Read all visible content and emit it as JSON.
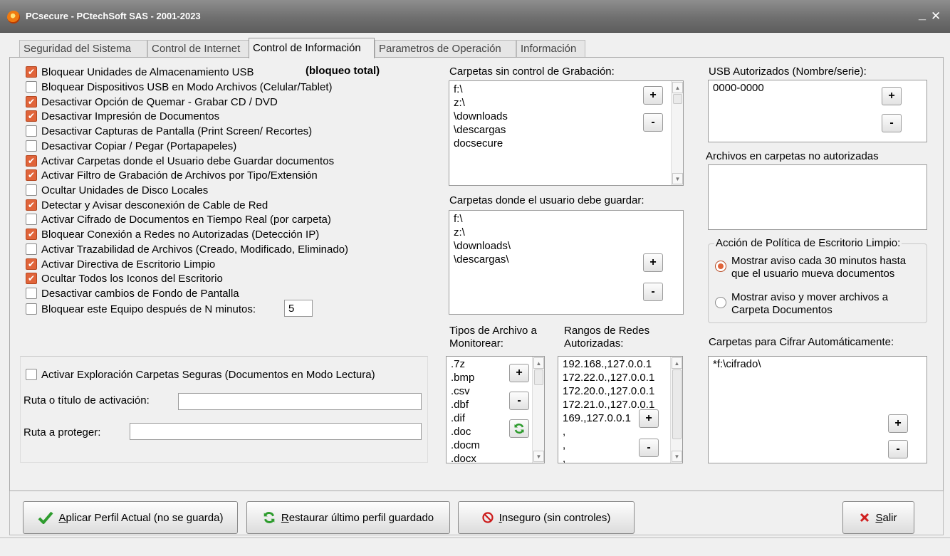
{
  "window": {
    "title": "PCsecure  -  PCtechSoft SAS - 2001-2023",
    "minimize_glyph": "_",
    "close_glyph": "✕"
  },
  "tabs": [
    {
      "label": "Seguridad del Sistema"
    },
    {
      "label": "Control de Internet"
    },
    {
      "label": "Control de Información"
    },
    {
      "label": "Parametros de Operación"
    },
    {
      "label": "Información"
    }
  ],
  "active_tab": "Control de Información",
  "options": [
    {
      "label": "Bloquear Unidades de Almacenamiento USB",
      "checked": true
    },
    {
      "label": "Bloquear Dispositivos USB en Modo Archivos (Celular/Tablet)",
      "checked": false
    },
    {
      "label": "Desactivar Opción de  Quemar - Grabar CD / DVD",
      "checked": true
    },
    {
      "label": "Desactivar Impresión de Documentos",
      "checked": true
    },
    {
      "label": "Desactivar Capturas de Pantalla (Print Screen/ Recortes)",
      "checked": false
    },
    {
      "label": "Desactivar Copiar / Pegar (Portapapeles)",
      "checked": false
    },
    {
      "label": "Activar Carpetas donde el Usuario debe Guardar documentos",
      "checked": true
    },
    {
      "label": "Activar Filtro de Grabación de Archivos por Tipo/Extensión",
      "checked": true
    },
    {
      "label": "Ocultar Unidades de Disco Locales",
      "checked": false
    },
    {
      "label": "Detectar y Avisar desconexión de Cable de Red",
      "checked": true
    },
    {
      "label": "Activar Cifrado de Documentos en Tiempo Real (por carpeta)",
      "checked": false
    },
    {
      "label": "Bloquear Conexión a Redes no Autorizadas (Detección IP)",
      "checked": true
    },
    {
      "label": "Activar Trazabilidad de Archivos (Creado, Modificado, Eliminado)",
      "checked": false
    },
    {
      "label": "Activar Directiva de Escritorio Limpio",
      "checked": true
    },
    {
      "label": "Ocultar Todos los Iconos del Escritorio",
      "checked": true
    },
    {
      "label": "Desactivar cambios de Fondo de Pantalla",
      "checked": false
    },
    {
      "label": "Bloquear este Equipo después de N minutos:",
      "checked": false
    }
  ],
  "bloqueo_total_label": "(bloqueo total)",
  "lock_minutes_value": "5",
  "secure_folders": {
    "checkbox_label": "Activar Exploración Carpetas Seguras (Documentos en Modo Lectura)",
    "checked": false,
    "activation_path_label": "Ruta o título de activación:",
    "activation_path_value": "",
    "protect_path_label": "Ruta a proteger:",
    "protect_path_value": ""
  },
  "no_control_folders": {
    "label": "Carpetas sin control de Grabación:",
    "items": [
      "f:\\",
      "z:\\",
      "\\downloads",
      "\\descargas",
      "docsecure"
    ]
  },
  "save_folders": {
    "label": "Carpetas donde el usuario debe guardar:",
    "items": [
      "f:\\",
      "z:\\",
      "\\downloads\\",
      "\\descargas\\"
    ]
  },
  "file_types": {
    "label_line1": "Tipos de Archivo a",
    "label_line2": "Monitorear:",
    "items": [
      ".7z",
      ".bmp",
      ".csv",
      ".dbf",
      ".dif",
      ".doc",
      ".docm",
      ".docx"
    ]
  },
  "network_ranges": {
    "label_line1": "Rangos de Redes",
    "label_line2": "Autorizadas:",
    "items": [
      "192.168.,127.0.0.1",
      "172.22.0.,127.0.0.1",
      "172.20.0.,127.0.0.1",
      "172.21.0.,127.0.0.1",
      "169.,127.0.0.1",
      ",",
      ",",
      ","
    ]
  },
  "usb_authorized": {
    "label": "USB Autorizados (Nombre/serie):",
    "items": [
      "0000-0000"
    ]
  },
  "unauthorized_files": {
    "label": "Archivos en carpetas no autorizadas",
    "items": []
  },
  "clean_desk_policy": {
    "title": "Acción de Política de Escritorio Limpio:",
    "options": [
      {
        "line1": "Mostrar aviso cada 30 minutos hasta",
        "line2": "que el usuario mueva documentos",
        "selected": true
      },
      {
        "line1": "Mostrar aviso y mover archivos a",
        "line2": "Carpeta Documentos",
        "selected": false
      }
    ]
  },
  "encrypt_folders": {
    "label": "Carpetas para Cifrar Automáticamente:",
    "items": [
      "*f:\\cifrado\\"
    ]
  },
  "small_buttons": {
    "add": "+",
    "remove": "-"
  },
  "buttons": {
    "apply": {
      "mnemonic": "A",
      "rest": "plicar Perfil Actual (no se guarda)"
    },
    "restore": {
      "mnemonic": "R",
      "rest": "estaurar último perfil guardado"
    },
    "insecure": {
      "mnemonic": "I",
      "rest": "nseguro (sin controles)"
    },
    "exit": {
      "mnemonic": "S",
      "rest": "alir"
    }
  },
  "colors": {
    "check_accent": "#e0643a",
    "titlebar": "#767676",
    "apply_icon": "#2e9c2e",
    "insecure_icon": "#cc1a1a",
    "exit_icon": "#d02020"
  },
  "icons": {
    "apply": "checkmark-icon",
    "restore": "refresh-icon",
    "insecure": "prohibited-icon",
    "exit": "x-icon",
    "refresh_small": "refresh-icon"
  }
}
